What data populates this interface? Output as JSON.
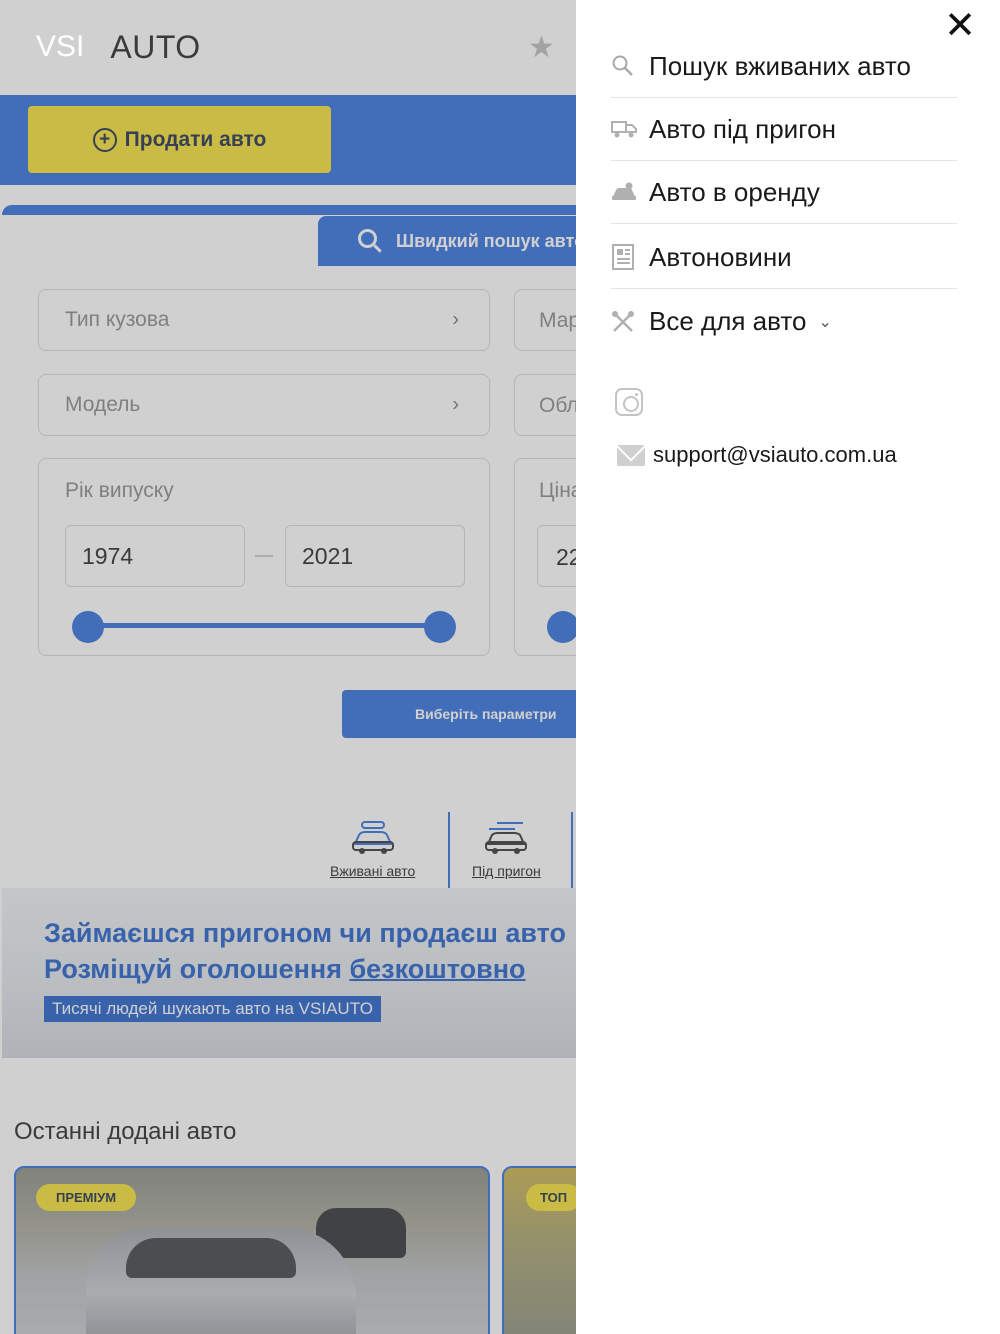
{
  "logo": {
    "part1": "VSI",
    "part2": "AUTO"
  },
  "header": {
    "sell_button": "Продати авто"
  },
  "search": {
    "quick_tab": "Швидкий пошук авто",
    "body_type": "Тип кузова",
    "brand_partial": "Марка",
    "model": "Модель",
    "region_partial": "Область",
    "year_label": "Рік випуску",
    "year_from": "1974",
    "year_to": "2021",
    "price_label_partial": "Ціна",
    "price_from_partial": "22",
    "submit": "Виберіть параметри"
  },
  "categories": [
    {
      "label": "Вживані авто"
    },
    {
      "label": "Під пригон"
    }
  ],
  "promo": {
    "line1": "Займаєшся пригоном чи продаєш авто",
    "line2_a": "Розміщуй оголошення ",
    "line2_b": "безкоштовно",
    "badge": "Тисячі людей шукають авто на VSIAUTO"
  },
  "recent": {
    "title": "Останні додані авто",
    "cards": [
      {
        "badge": "ПРЕМІУМ"
      },
      {
        "badge": "ТОП"
      }
    ]
  },
  "menu": {
    "close": "✕",
    "items": [
      {
        "label": "Пошук вживаних авто",
        "icon": "search-icon"
      },
      {
        "label": "Авто під пригон",
        "icon": "truck-icon"
      },
      {
        "label": "Авто в оренду",
        "icon": "car-rent-icon"
      },
      {
        "label": "Автоновини",
        "icon": "news-icon"
      },
      {
        "label": "Все для авто",
        "icon": "tools-icon"
      }
    ],
    "email": "support@vsiauto.com.ua"
  }
}
